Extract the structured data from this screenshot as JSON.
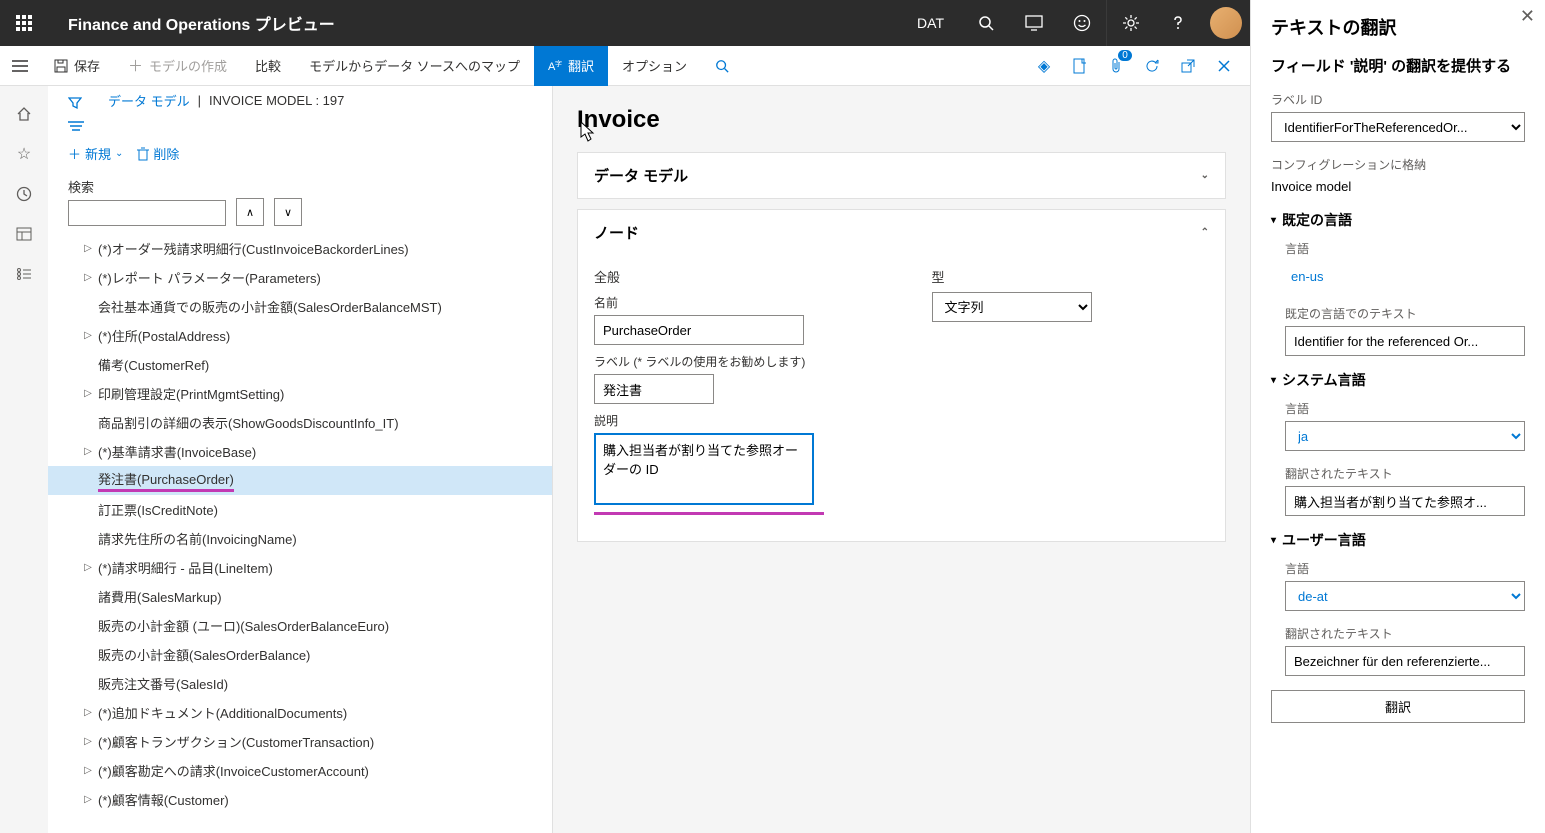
{
  "header": {
    "app_title": "Finance and Operations プレビュー",
    "company": "DAT"
  },
  "actions": {
    "save": "保存",
    "create_model": "モデルの作成",
    "compare": "比較",
    "map_model": "モデルからデータ ソースへのマップ",
    "translate": "翻訳",
    "options": "オプション",
    "badge_count": "0"
  },
  "breadcrumb": {
    "link": "データ モデル",
    "current": "INVOICE MODEL : 197"
  },
  "tree_actions": {
    "new": "新規",
    "delete": "削除"
  },
  "search": {
    "label": "検索"
  },
  "tree": {
    "items": [
      {
        "label": "(*)オーダー残請求明細行(CustInvoiceBackorderLines)",
        "expandable": true
      },
      {
        "label": "(*)レポート パラメーター(Parameters)",
        "expandable": true
      },
      {
        "label": "会社基本通貨での販売の小計金額(SalesOrderBalanceMST)",
        "expandable": false
      },
      {
        "label": "(*)住所(PostalAddress)",
        "expandable": true
      },
      {
        "label": "備考(CustomerRef)",
        "expandable": false
      },
      {
        "label": "印刷管理設定(PrintMgmtSetting)",
        "expandable": true
      },
      {
        "label": "商品割引の詳細の表示(ShowGoodsDiscountInfo_IT)",
        "expandable": false
      },
      {
        "label": "(*)基準請求書(InvoiceBase)",
        "expandable": true
      },
      {
        "label": "発注書(PurchaseOrder)",
        "expandable": false,
        "selected": true
      },
      {
        "label": "訂正票(IsCreditNote)",
        "expandable": false
      },
      {
        "label": "請求先住所の名前(InvoicingName)",
        "expandable": false
      },
      {
        "label": "(*)請求明細行 - 品目(LineItem)",
        "expandable": true
      },
      {
        "label": "諸費用(SalesMarkup)",
        "expandable": false
      },
      {
        "label": "販売の小計金額 (ユーロ)(SalesOrderBalanceEuro)",
        "expandable": false
      },
      {
        "label": "販売の小計金額(SalesOrderBalance)",
        "expandable": false
      },
      {
        "label": "販売注文番号(SalesId)",
        "expandable": false
      },
      {
        "label": "(*)追加ドキュメント(AdditionalDocuments)",
        "expandable": true
      },
      {
        "label": "(*)顧客トランザクション(CustomerTransaction)",
        "expandable": true
      },
      {
        "label": "(*)顧客勘定への請求(InvoiceCustomerAccount)",
        "expandable": true
      },
      {
        "label": "(*)顧客情報(Customer)",
        "expandable": true
      }
    ]
  },
  "detail": {
    "title": "Invoice",
    "card1_title": "データ モデル",
    "card2_title": "ノード",
    "general": "全般",
    "name_label": "名前",
    "name_value": "PurchaseOrder",
    "label_label": "ラベル (* ラベルの使用をお勧めします)",
    "label_value": "発注書",
    "desc_label": "説明",
    "desc_value": "購入担当者が割り当てた参照オーダーの ID",
    "type_label": "型",
    "type_value": "文字列"
  },
  "side": {
    "title": "テキストの翻訳",
    "subtitle": "フィールド '説明' の翻訳を提供する",
    "label_id_label": "ラベル ID",
    "label_id_value": "IdentifierForTheReferencedOr...",
    "config_label": "コンフィグレーションに格納",
    "config_value": "Invoice model",
    "sections": {
      "default_lang_title": "既定の言語",
      "lang_label": "言語",
      "default_lang_value": "en-us",
      "default_text_label": "既定の言語でのテキスト",
      "default_text_value": "Identifier for the referenced Or...",
      "system_lang_title": "システム言語",
      "system_lang_value": "ja",
      "translated_text_label": "翻訳されたテキスト",
      "system_translated_value": "購入担当者が割り当てた参照オ...",
      "user_lang_title": "ユーザー言語",
      "user_lang_value": "de-at",
      "user_translated_value": "Bezeichner für den referenzierte..."
    },
    "translate_btn": "翻訳"
  }
}
